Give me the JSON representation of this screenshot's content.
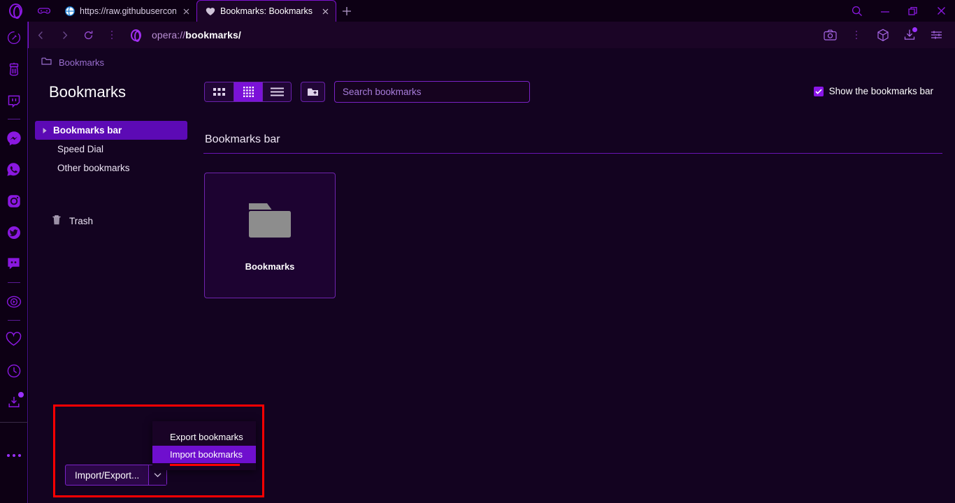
{
  "window": {
    "controls": {
      "search": "search-icon",
      "minimize": "minimize-icon",
      "restore": "restore-icon",
      "close": "close-icon"
    }
  },
  "tabs": [
    {
      "title": "https://raw.githubuserconte",
      "favicon": "globe-icon",
      "active": false
    },
    {
      "title": "Bookmarks: Bookmarks bar",
      "favicon": "heart-icon",
      "active": true
    }
  ],
  "newtab_label": "+",
  "address_bar": {
    "url_scheme": "opera://",
    "url_path": "bookmarks/",
    "back": "back-arrow-icon",
    "forward": "forward-arrow-icon",
    "reload": "reload-icon",
    "icons": [
      "camera-icon",
      "cube-icon",
      "download-icon",
      "easy-setup-icon"
    ]
  },
  "rail": {
    "items": [
      {
        "name": "opera-logo-icon"
      },
      {
        "name": "broom-icon"
      },
      {
        "name": "twitch-icon"
      },
      {
        "name": "separator"
      },
      {
        "name": "messenger-icon"
      },
      {
        "name": "whatsapp-icon"
      },
      {
        "name": "instagram-icon"
      },
      {
        "name": "twitter-icon"
      },
      {
        "name": "discord-icon"
      },
      {
        "name": "separator"
      },
      {
        "name": "player-icon"
      },
      {
        "name": "separator"
      },
      {
        "name": "heart-icon"
      },
      {
        "name": "history-icon"
      },
      {
        "name": "downloads-icon"
      },
      {
        "name": "more-icon"
      }
    ]
  },
  "breadcrumb": {
    "icon": "folder-icon",
    "label": "Bookmarks"
  },
  "panel": {
    "title": "Bookmarks"
  },
  "tree": {
    "items": [
      {
        "label": "Bookmarks bar",
        "selected": true,
        "caret": "▶"
      },
      {
        "label": "Speed Dial",
        "selected": false
      },
      {
        "label": "Other bookmarks",
        "selected": false
      }
    ],
    "trash": {
      "label": "Trash",
      "icon": "trash-icon"
    }
  },
  "toolbar": {
    "views": [
      {
        "name": "large-grid-view",
        "active": false
      },
      {
        "name": "small-grid-view",
        "active": true
      },
      {
        "name": "list-view",
        "active": false
      }
    ],
    "new_folder": "new-folder-icon",
    "search": {
      "placeholder": "Search bookmarks",
      "value": ""
    }
  },
  "show_bookmarks_bar": {
    "label": "Show the bookmarks bar",
    "checked": true
  },
  "content": {
    "section_title": "Bookmarks bar",
    "cards": [
      {
        "label": "Bookmarks",
        "icon": "folder-icon"
      }
    ]
  },
  "import_export": {
    "button_label": "Import/Export...",
    "chevron": "chevron-down-icon",
    "menu": [
      {
        "label": "Export bookmarks",
        "highlighted": false
      },
      {
        "label": "Import bookmarks",
        "highlighted": true
      }
    ]
  },
  "colors": {
    "accent": "#7b12d8",
    "selection": "#5c0ab5",
    "annotation": "#ff0000",
    "page_bg": "#130320",
    "chrome_bg": "#0d0014"
  }
}
